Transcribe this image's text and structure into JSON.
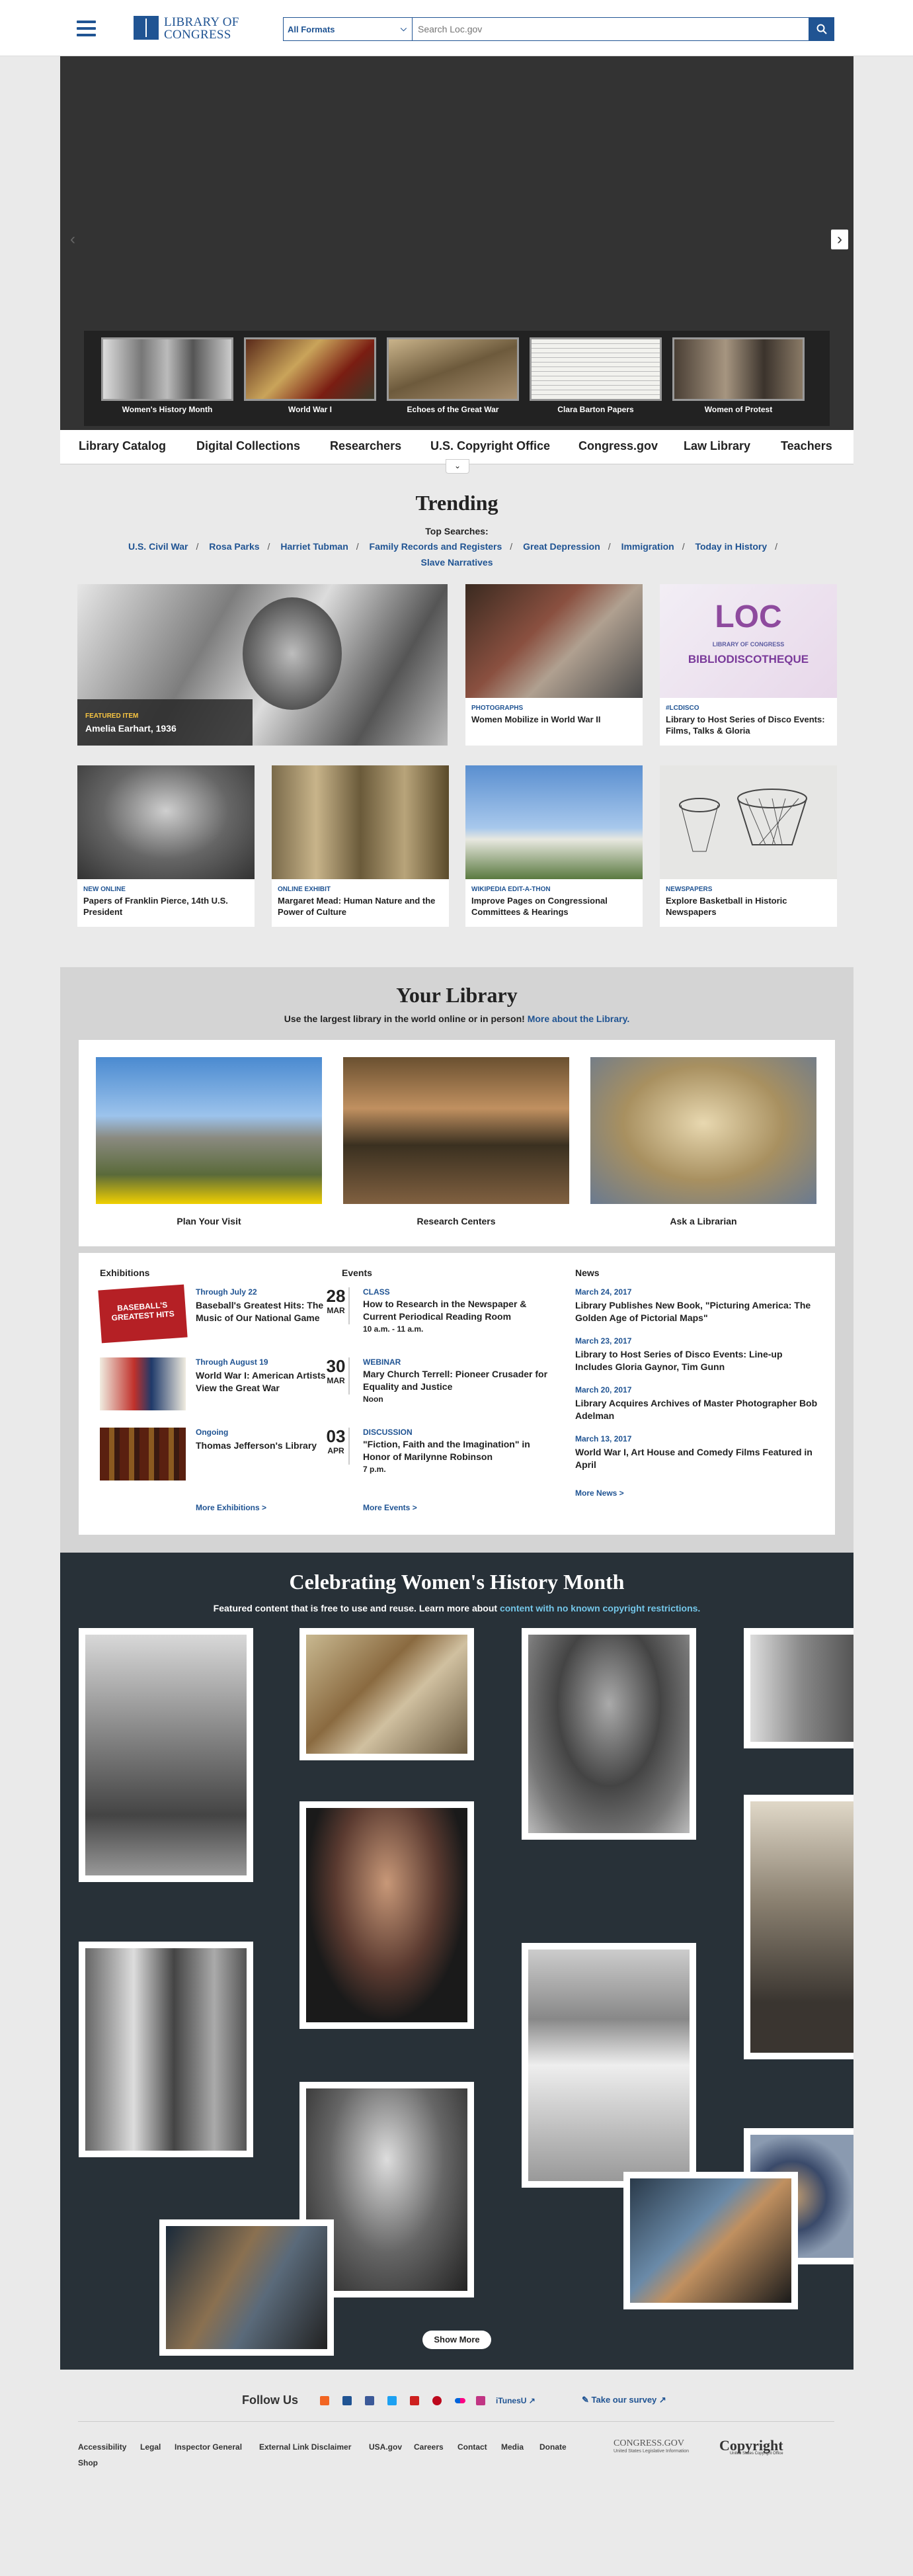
{
  "header": {
    "formats": "All Formats",
    "search_placeholder": "Search Loc.gov",
    "logo_line1": "LIBRARY OF",
    "logo_line2": "CONGRESS"
  },
  "carousel": {
    "thumbs": [
      "Women's History Month",
      "World War I",
      "Echoes of the Great War",
      "Clara Barton Papers",
      "Women of Protest"
    ]
  },
  "nav": [
    "Library Catalog",
    "Digital Collections",
    "Researchers",
    "U.S. Copyright Office",
    "Congress.gov",
    "Law Library",
    "Teachers"
  ],
  "trending": {
    "title": "Trending",
    "top_label": "Top Searches:",
    "searches": [
      "U.S. Civil War",
      "Rosa Parks",
      "Harriet Tubman",
      "Family Records and Registers",
      "Great Depression",
      "Immigration",
      "Today in History",
      "Slave Narratives"
    ],
    "featured": {
      "kicker": "FEATURED ITEM",
      "title": "Amelia Earhart, 1936"
    },
    "cards": [
      {
        "kicker": "PHOTOGRAPHS",
        "title": "Women Mobilize in World War II"
      },
      {
        "kicker": "#LCDISCO",
        "title": "Library to Host Series of Disco Events: Films, Talks & Gloria"
      },
      {
        "kicker": "NEW ONLINE",
        "title": "Papers of Franklin Pierce, 14th U.S. President"
      },
      {
        "kicker": "ONLINE EXHIBIT",
        "title": "Margaret Mead: Human Nature and the Power of Culture"
      },
      {
        "kicker": "WIKIPEDIA EDIT-A-THON",
        "title": "Improve Pages on Congressional Committees & Hearings"
      },
      {
        "kicker": "NEWSPAPERS",
        "title": "Explore Basketball in Historic Newspapers"
      }
    ],
    "disco_loc": "LOC",
    "disco_sub": "LIBRARY OF CONGRESS",
    "disco_word": "BIBLIODISCOTHEQUE"
  },
  "library": {
    "title": "Your Library",
    "subtitle": "Use the largest library in the world online or in person!",
    "sub_link": "More about the Library.",
    "cards": [
      "Plan Your Visit",
      "Research Centers",
      "Ask a Librarian"
    ]
  },
  "exhibitions": {
    "heading": "Exhibitions",
    "items": [
      {
        "date": "Through July 22",
        "title": "Baseball's Greatest Hits: The Music of Our National Game",
        "badge": "BASEBALL'S GREATEST HITS"
      },
      {
        "date": "Through August 19",
        "title": "World War I: American Artists View the Great War"
      },
      {
        "date": "Ongoing",
        "title": "Thomas Jefferson's Library"
      }
    ],
    "more": "More Exhibitions >"
  },
  "events": {
    "heading": "Events",
    "items": [
      {
        "day": "28",
        "mon": "MAR",
        "kind": "CLASS",
        "title": "How to Research in the Newspaper & Current Periodical Reading Room",
        "time": "10 a.m. - 11 a.m."
      },
      {
        "day": "30",
        "mon": "MAR",
        "kind": "WEBINAR",
        "title": "Mary Church Terrell: Pioneer Crusader for Equality and Justice",
        "time": "Noon"
      },
      {
        "day": "03",
        "mon": "APR",
        "kind": "DISCUSSION",
        "title": "\"Fiction, Faith and the Imagination\" in Honor of Marilynne Robinson",
        "time": "7 p.m."
      }
    ],
    "more": "More Events >"
  },
  "news": {
    "heading": "News",
    "items": [
      {
        "date": "March 24, 2017",
        "title": "Library Publishes New Book, \"Picturing America: The Golden Age of Pictorial Maps\""
      },
      {
        "date": "March 23, 2017",
        "title": "Library to Host Series of Disco Events: Line-up Includes Gloria Gaynor, Tim Gunn"
      },
      {
        "date": "March 20, 2017",
        "title": "Library Acquires Archives of Master Photographer Bob Adelman"
      },
      {
        "date": "March 13, 2017",
        "title": "World War I, Art House and Comedy Films Featured in April"
      }
    ],
    "more": "More News >"
  },
  "women": {
    "title": "Celebrating Women's History Month",
    "subtitle": "Featured content that is free to use and reuse. Learn more about",
    "sub_link": "content with no known copyright restrictions.",
    "show_more": "Show More"
  },
  "footer": {
    "follow": "Follow Us",
    "itunes": "iTunesU",
    "survey": "Take our survey",
    "links": [
      "Accessibility",
      "Legal",
      "Inspector General",
      "External Link Disclaimer",
      "USA.gov",
      "Careers",
      "Contact",
      "Media",
      "Donate",
      "Shop"
    ],
    "congress": "CONGRESS.GOV",
    "congress_sub": "United States Legislative Information",
    "copyright": "Copyright",
    "copyright_sub": "United States Copyright Office"
  },
  "colors": {
    "brand": "#205493",
    "dark": "#283138",
    "accent": "#74c6e8",
    "featured": "#f9c642"
  }
}
